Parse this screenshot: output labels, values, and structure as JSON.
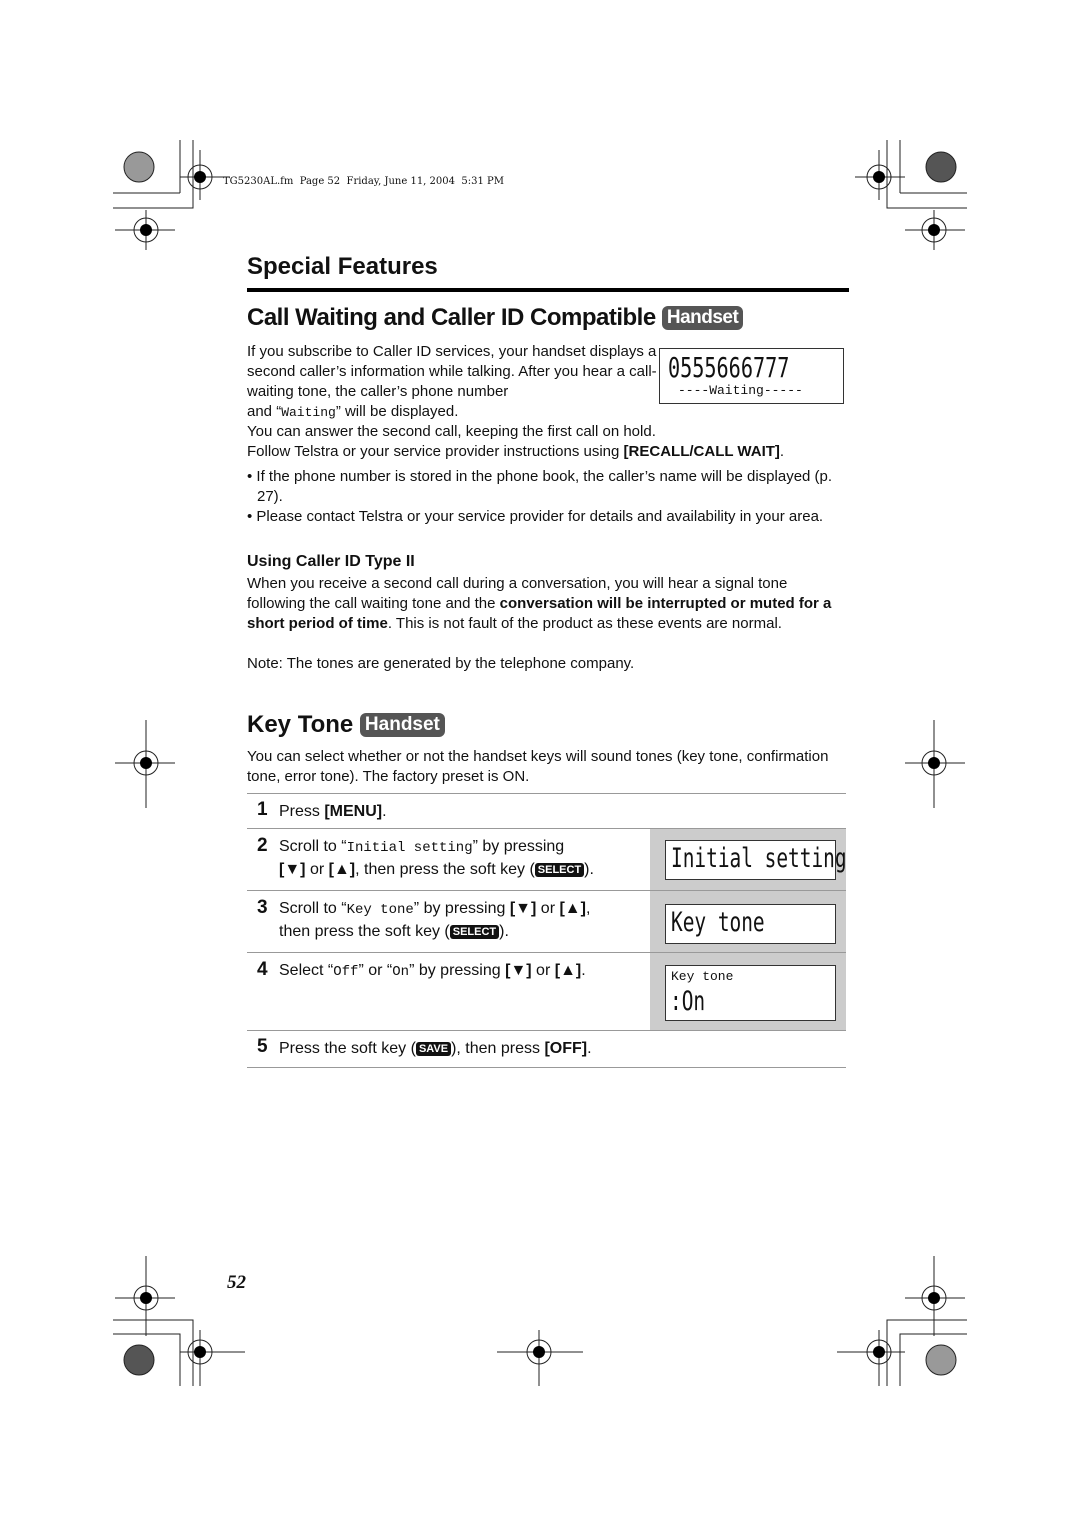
{
  "file_header": "TG5230AL.fm  Page 52  Friday, June 11, 2004  5:31 PM",
  "section_title": "Special Features",
  "call_waiting": {
    "title": "Call Waiting and Caller ID Compatible",
    "badge": "Handset",
    "lcd_number": "0555666777",
    "lcd_status": "----Waiting-----",
    "p1": "If you subscribe to Caller ID services, your handset displays a second caller’s information while talking. After you hear a call-waiting tone, the caller’s phone number",
    "p1_end_pre": "and “",
    "p1_code": "Waiting",
    "p1_end_post": "” will be displayed.",
    "p2": "You can answer the second call, keeping the first call on hold.",
    "p3_pre": "Follow Telstra or your service provider instructions using ",
    "p3_bold": "[RECALL/CALL WAIT]",
    "p3_post": ".",
    "bullets": [
      "If the phone number is stored in the phone book, the caller’s name will be displayed (p. 27).",
      "Please contact Telstra or your service provider for details and availability in your area."
    ],
    "subhead": "Using Caller ID Type II",
    "p4_pre": "When you receive a second call during a conversation, you will hear a signal tone following the call waiting tone and the ",
    "p4_bold": "conversation will be interrupted or muted for a short period of time",
    "p4_post": ". This is not fault of the product as these events are normal.",
    "note": "Note: The tones are generated by the telephone company."
  },
  "key_tone": {
    "title": "Key Tone",
    "badge": "Handset",
    "intro": "You can select whether or not the handset keys will sound tones (key tone, confirmation tone, error tone). The factory preset is ON.",
    "steps": [
      {
        "num": "1",
        "pre": "Press ",
        "bold": "[MENU]",
        "post": "."
      },
      {
        "num": "2",
        "a": "Scroll to “",
        "code": "Initial setting",
        "b": "” by pressing",
        "c": "[▼]",
        "d": " or ",
        "e": "[▲]",
        "f": ", then press the soft key (",
        "key": "SELECT",
        "g": ").",
        "lcd": "Initial setting"
      },
      {
        "num": "3",
        "a": "Scroll to “",
        "code": "Key tone",
        "b": "” by pressing ",
        "c": "[▼]",
        "d": " or ",
        "e": "[▲]",
        "f": ",",
        "g": "then press the soft key (",
        "key": "SELECT",
        "h": ").",
        "lcd": "Key tone"
      },
      {
        "num": "4",
        "a": "Select “",
        "code1": "Off",
        "b": "” or “",
        "code2": "On",
        "c": "” by pressing ",
        "d": "[▼]",
        "e": " or ",
        "f": "[▲]",
        "g": ".",
        "lcd_small": "Key tone",
        "lcd": ":On"
      },
      {
        "num": "5",
        "a": "Press the soft key (",
        "key": "SAVE",
        "b": "), then press ",
        "bold": "[OFF]",
        "c": "."
      }
    ]
  },
  "page_number": "52",
  "colors": {
    "badge": "#555555",
    "step_panel": "#cccccc"
  }
}
